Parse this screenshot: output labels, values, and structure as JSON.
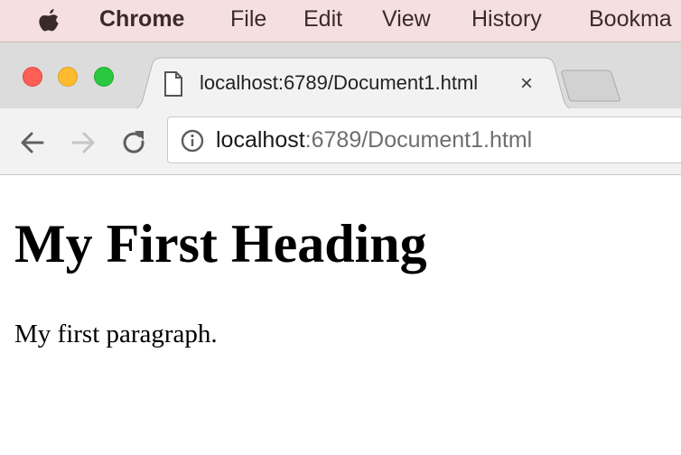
{
  "menubar": {
    "app_name": "Chrome",
    "items": [
      "File",
      "Edit",
      "View",
      "History",
      "Bookma"
    ]
  },
  "tab": {
    "title": "localhost:6789/Document1.html",
    "close_glyph": "×"
  },
  "omnibox": {
    "host": "localhost",
    "rest": ":6789/Document1.html"
  },
  "page": {
    "heading": "My First Heading",
    "paragraph": "My first paragraph."
  },
  "colors": {
    "menubar_bg": "#f6dfe0",
    "tabstrip_bg": "#dcdcdc",
    "toolbar_bg": "#f2f2f2",
    "close": "#fd5f57",
    "minimize": "#febb2e",
    "zoom": "#29c840"
  }
}
